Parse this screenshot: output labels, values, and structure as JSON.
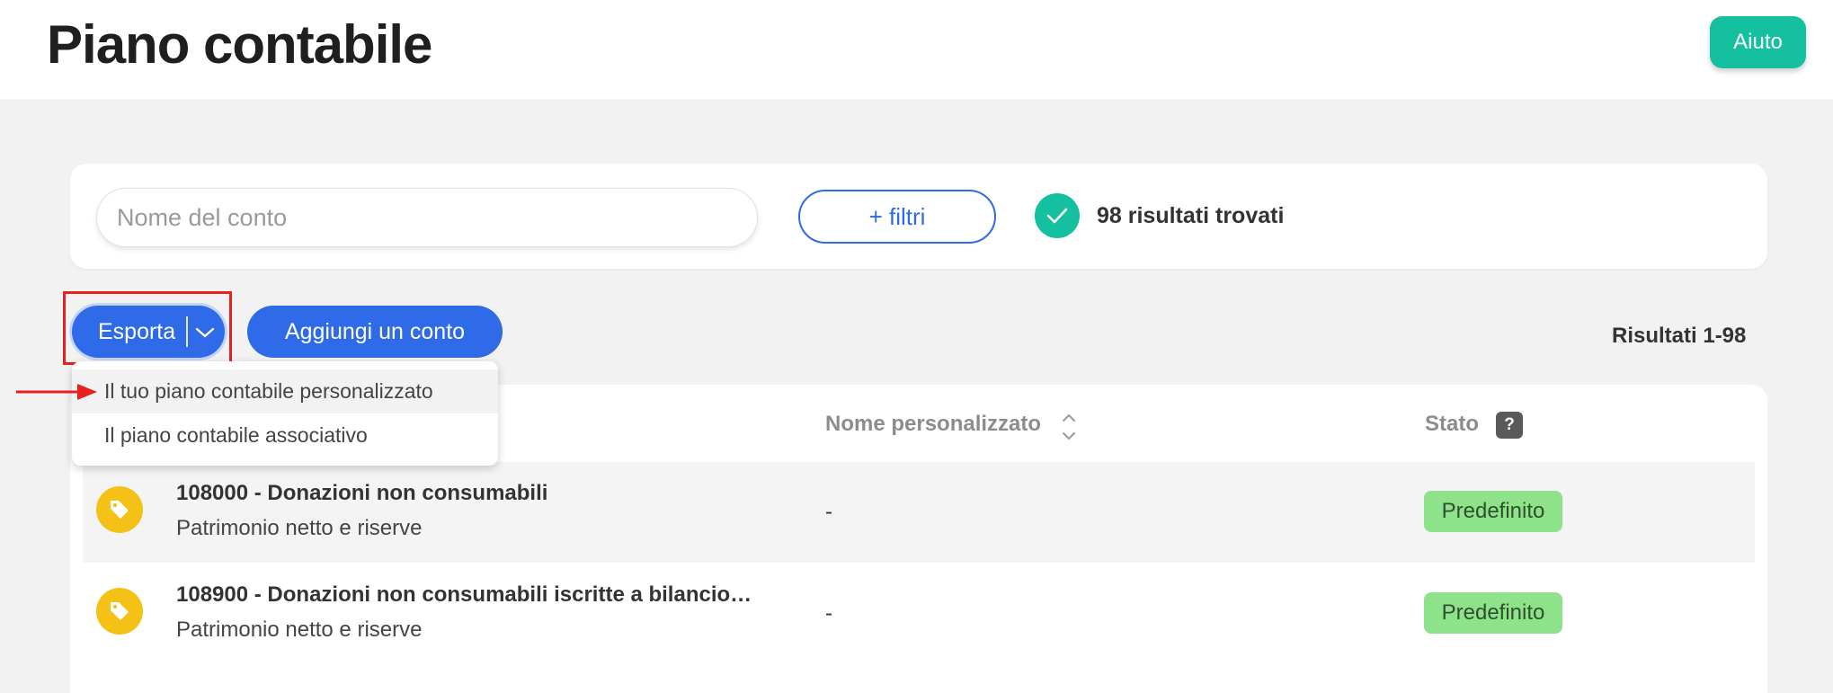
{
  "header": {
    "title": "Piano contabile",
    "help_label": "Aiuto"
  },
  "filters": {
    "search_placeholder": "Nome del conto",
    "filters_button_label": "+ filtri",
    "results_found": "98 risultati trovati"
  },
  "toolbar": {
    "export_label": "Esporta",
    "add_account_label": "Aggiungi un conto",
    "results_range": "Risultati 1-98"
  },
  "export_menu": {
    "items": [
      {
        "label": "Il tuo piano contabile personalizzato",
        "hovered": true
      },
      {
        "label": "Il piano contabile associativo",
        "hovered": false
      }
    ]
  },
  "table": {
    "columns": {
      "custom_name": "Nome personalizzato",
      "status": "Stato",
      "status_help": "?"
    },
    "rows": [
      {
        "title": "108000 - Donazioni non consumabili",
        "subtitle": "Patrimonio netto e riserve",
        "custom_name": "-",
        "status": "Predefinito",
        "icon": "tag-icon"
      },
      {
        "title": "108900 - Donazioni non consumabili iscritte a bilancio…",
        "subtitle": "Patrimonio netto e riserve",
        "custom_name": "-",
        "status": "Predefinito",
        "icon": "tag-icon"
      }
    ]
  },
  "colors": {
    "primary": "#2f6ae8",
    "teal": "#14c0a0",
    "status_green": "#8ee38a",
    "tag_yellow": "#f5c116",
    "highlight_red": "#e8201e"
  }
}
